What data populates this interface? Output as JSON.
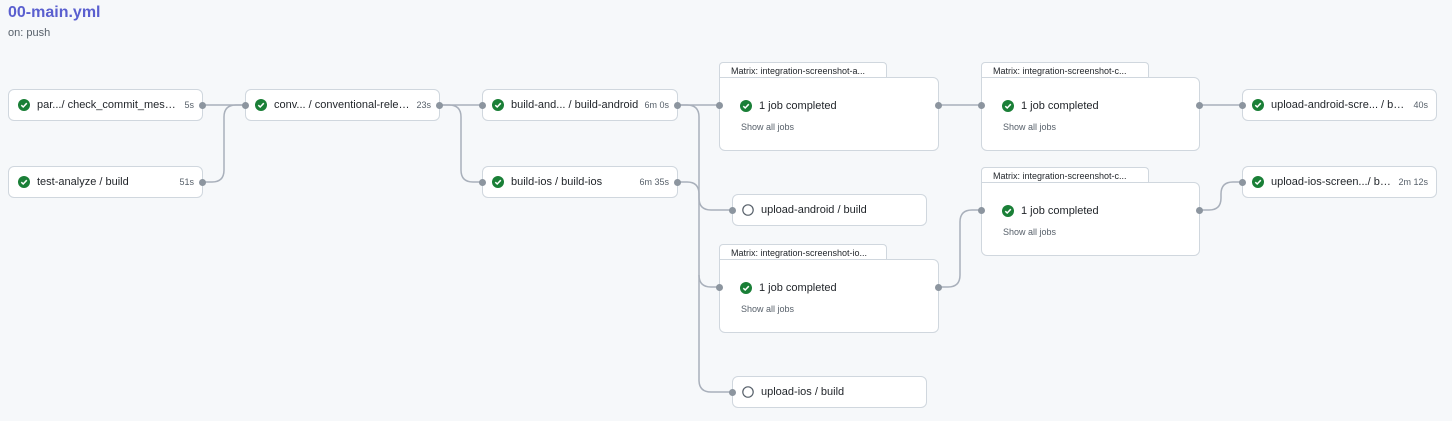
{
  "workflow": {
    "title": "00-main.yml",
    "trigger": "on: push"
  },
  "colors": {
    "success": "#1a7f37",
    "pending": "#57606a",
    "edge": "#a9b0bb",
    "title": "#5a5fcf"
  },
  "icons": {
    "success": "check-circle-icon",
    "pending": "circle-icon"
  },
  "jobs": [
    {
      "id": "parse",
      "name": "par.../ check_commit_message",
      "duration": "5s",
      "status": "success"
    },
    {
      "id": "test",
      "name": "test-analyze / build",
      "duration": "51s",
      "status": "success"
    },
    {
      "id": "conv",
      "name": "conv... / conventional-release",
      "duration": "23s",
      "status": "success"
    },
    {
      "id": "build_android",
      "name": "build-and... / build-android",
      "duration": "6m 0s",
      "status": "success"
    },
    {
      "id": "build_ios",
      "name": "build-ios / build-ios",
      "duration": "6m 35s",
      "status": "success"
    },
    {
      "id": "upload_android",
      "name": "upload-android / build",
      "duration": "",
      "status": "pending"
    },
    {
      "id": "upload_ios",
      "name": "upload-ios / build",
      "duration": "",
      "status": "pending"
    },
    {
      "id": "upload_android_screens",
      "name": "upload-android-scre... / build",
      "duration": "40s",
      "status": "success"
    },
    {
      "id": "upload_ios_screens",
      "name": "upload-ios-screen.../ build",
      "duration": "2m 12s",
      "status": "success"
    }
  ],
  "matrices": [
    {
      "id": "m1",
      "title": "Matrix: integration-screenshot-a...",
      "summary": "1 job completed",
      "link": "Show all jobs",
      "status": "success"
    },
    {
      "id": "m2",
      "title": "Matrix: integration-screenshot-c...",
      "summary": "1 job completed",
      "link": "Show all jobs",
      "status": "success"
    },
    {
      "id": "m3",
      "title": "Matrix: integration-screenshot-c...",
      "summary": "1 job completed",
      "link": "Show all jobs",
      "status": "success"
    },
    {
      "id": "m4",
      "title": "Matrix: integration-screenshot-io...",
      "summary": "1 job completed",
      "link": "Show all jobs",
      "status": "success"
    }
  ]
}
